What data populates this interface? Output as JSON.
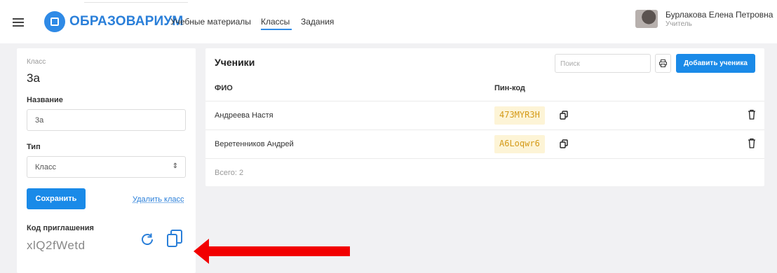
{
  "header": {
    "brand": "ОБРАЗОВАРИУМ",
    "nav": [
      {
        "label": "Учебные материалы",
        "active": false
      },
      {
        "label": "Классы",
        "active": true
      },
      {
        "label": "Задания",
        "active": false
      }
    ],
    "user": {
      "name": "Бурлакова Елена Петровна",
      "role": "Учитель"
    },
    "icons": {
      "menu": "hamburger-icon",
      "logo": "logo-icon",
      "avatar": "avatar"
    }
  },
  "class_panel": {
    "class_label": "Класс",
    "class_name": "3а",
    "name_label": "Название",
    "name_value": "3а",
    "type_label": "Тип",
    "type_value": "Класс",
    "save_label": "Сохранить",
    "delete_label": "Удалить класс",
    "invite_label": "Код приглашения",
    "invite_code": "xlQ2fWetd",
    "icons": {
      "refresh": "refresh-icon",
      "copy": "copy-icon"
    }
  },
  "students": {
    "title": "Ученики",
    "search_placeholder": "Поиск",
    "add_label": "Добавить ученика",
    "columns": [
      "ФИО",
      "Пин-код"
    ],
    "rows": [
      {
        "name": "Андреева Настя",
        "pin": "473MYR3H"
      },
      {
        "name": "Веретенников Андрей",
        "pin": "A6Loqwr6"
      }
    ],
    "total": "Всего: 2",
    "icons": {
      "print": "printer-icon",
      "copy": "copy-icon",
      "delete": "trash-icon"
    }
  },
  "colors": {
    "accent": "#1a8ae8",
    "brand": "#2a7fd9",
    "pin_bg": "#fdf4d6",
    "pin_text": "#d49a18",
    "annotation": "#f20000"
  }
}
